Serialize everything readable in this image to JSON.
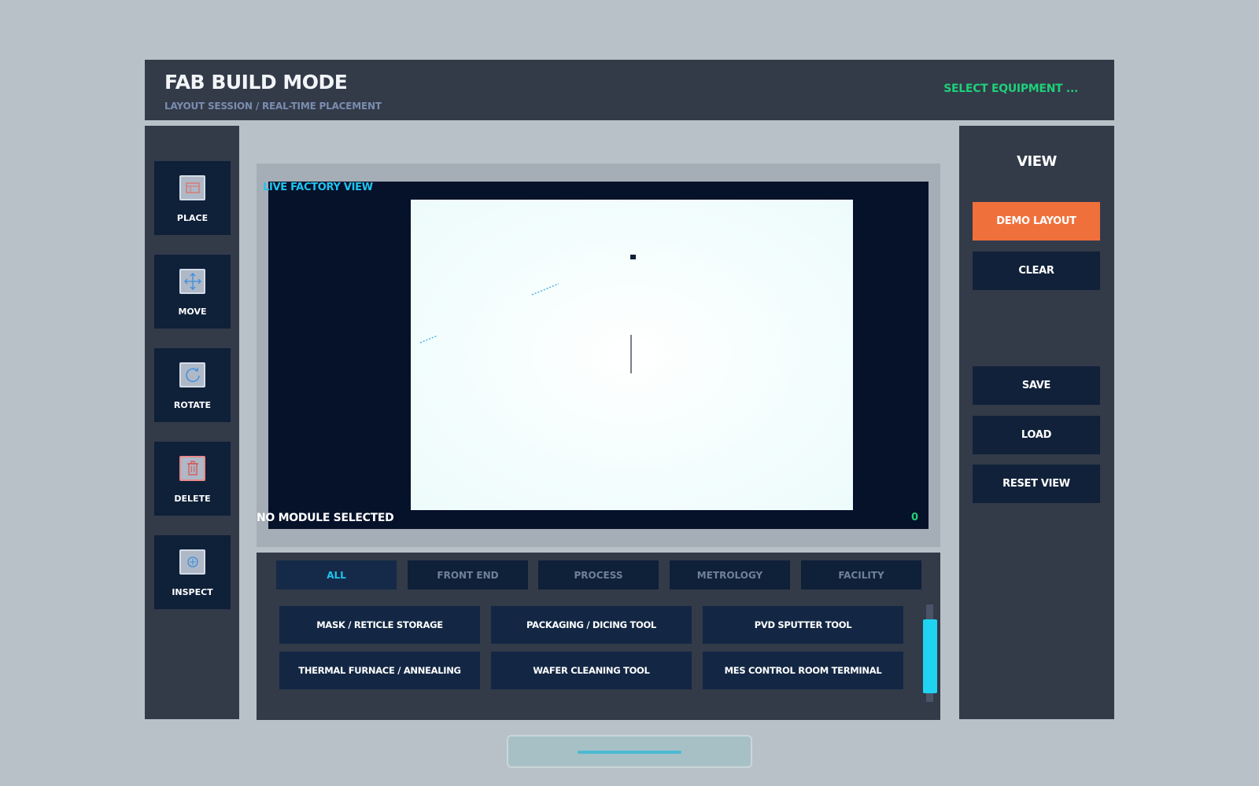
{
  "header": {
    "title": "FAB BUILD MODE",
    "subtitle": "LAYOUT SESSION / REAL-TIME PLACEMENT",
    "status": "SELECT EQUIPMENT ..."
  },
  "tools": [
    {
      "label": "PLACE",
      "icon": "place-icon"
    },
    {
      "label": "MOVE",
      "icon": "move-icon"
    },
    {
      "label": "ROTATE",
      "icon": "rotate-icon"
    },
    {
      "label": "DELETE",
      "icon": "trash-icon"
    },
    {
      "label": "INSPECT",
      "icon": "inspect-icon"
    }
  ],
  "view_panel": {
    "title": "VIEW",
    "demo_layout": "DEMO LAYOUT",
    "clear": "CLEAR",
    "save": "SAVE",
    "load": "LOAD",
    "reset_view": "RESET VIEW"
  },
  "viewport": {
    "label": "LIVE FACTORY VIEW",
    "status": "NO MODULE SELECTED",
    "count": "0"
  },
  "catalog": {
    "tabs": [
      "ALL",
      "FRONT END",
      "PROCESS",
      "METROLOGY",
      "FACILITY"
    ],
    "active_tab": "ALL",
    "items": [
      "MASK / RETICLE STORAGE",
      "PACKAGING / DICING TOOL",
      "PVD SPUTTER TOOL",
      "THERMAL FURNACE / ANNEALING",
      "WAFER CLEANING TOOL",
      "MES CONTROL ROOM TERMINAL"
    ]
  },
  "colors": {
    "background": "#b9c1c8",
    "panel": "#333a48",
    "button": "#0f2039",
    "accent_cyan": "#1fc4f0",
    "accent_green": "#1fd07a",
    "accent_orange": "#f0703b"
  }
}
